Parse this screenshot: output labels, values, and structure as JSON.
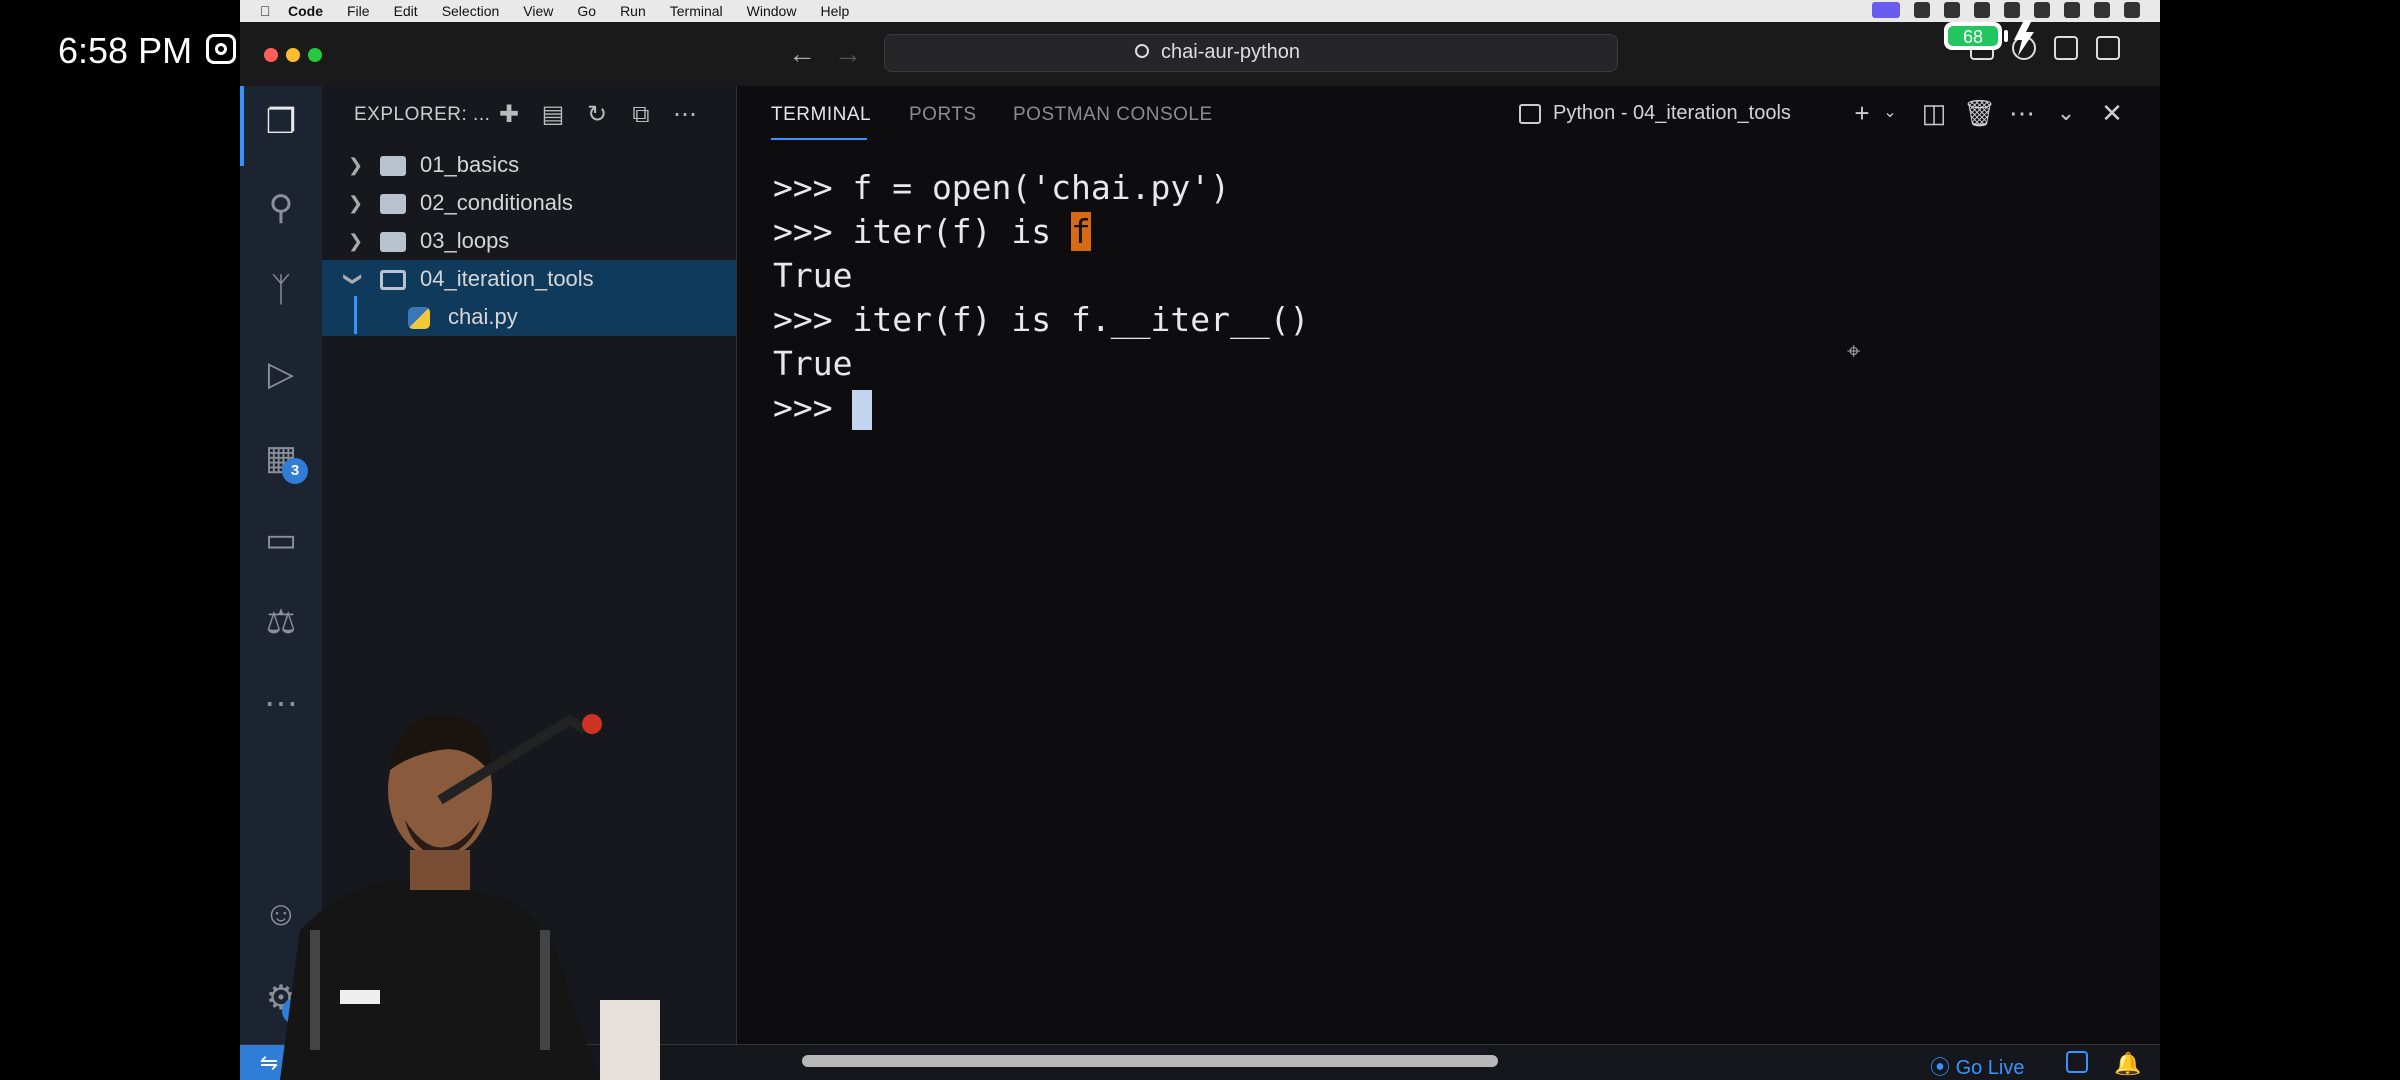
{
  "phone": {
    "time": "6:58 PM",
    "battery": "68"
  },
  "menubar": {
    "items": [
      "Code",
      "File",
      "Edit",
      "Selection",
      "View",
      "Go",
      "Run",
      "Terminal",
      "Window",
      "Help"
    ]
  },
  "titlebar": {
    "search_text": "chai-aur-python"
  },
  "activitybar": {
    "extensions_badge": "3",
    "settings_badge": "1"
  },
  "explorer": {
    "header": "EXPLORER: ...",
    "items": [
      {
        "label": "01_basics",
        "type": "folder",
        "expanded": false
      },
      {
        "label": "02_conditionals",
        "type": "folder",
        "expanded": false
      },
      {
        "label": "03_loops",
        "type": "folder",
        "expanded": false
      },
      {
        "label": "04_iteration_tools",
        "type": "folder",
        "expanded": true,
        "selected": true
      },
      {
        "label": "chai.py",
        "type": "file",
        "selected": true
      }
    ]
  },
  "panel": {
    "tabs": [
      "TERMINAL",
      "PORTS",
      "POSTMAN CONSOLE"
    ],
    "active_tab": "TERMINAL",
    "terminal_name": "Python - 04_iteration_tools"
  },
  "terminal": {
    "lines": [
      ">>> f = open('chai.py')",
      ">>> iter(f) is ",
      "True",
      ">>> iter(f) is f.__iter__()",
      "True",
      ">>> "
    ],
    "highlight_char": "f"
  },
  "statusbar": {
    "golive": "Go Live"
  },
  "colors": {
    "accent": "#3794ff",
    "highlight": "#d96a14"
  }
}
